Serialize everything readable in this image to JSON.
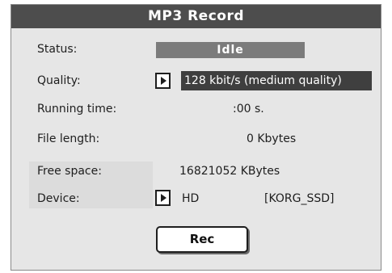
{
  "window": {
    "title": "MP3 Record"
  },
  "fields": {
    "status_label": "Status:",
    "status_value": "Idle",
    "quality_label": "Quality:",
    "quality_value": "128 kbit/s (medium quality)",
    "running_time_label": "Running time:",
    "running_time_value": ":00 s.",
    "file_length_label": "File length:",
    "file_length_value": "0 Kbytes",
    "free_space_label": "Free space:",
    "free_space_value": "16821052 KBytes",
    "device_label": "Device:",
    "device_value": "HD",
    "device_name": "[KORG_SSD]"
  },
  "buttons": {
    "rec_label": "Rec"
  },
  "icons": {
    "quality_selector": "play-arrow-icon",
    "device_selector": "play-arrow-icon"
  },
  "colors": {
    "title_bar": "#4d4d4d",
    "panel_bg": "#e6e6e6",
    "status_box": "#7b7b7b",
    "quality_box": "#3f3f3f"
  }
}
